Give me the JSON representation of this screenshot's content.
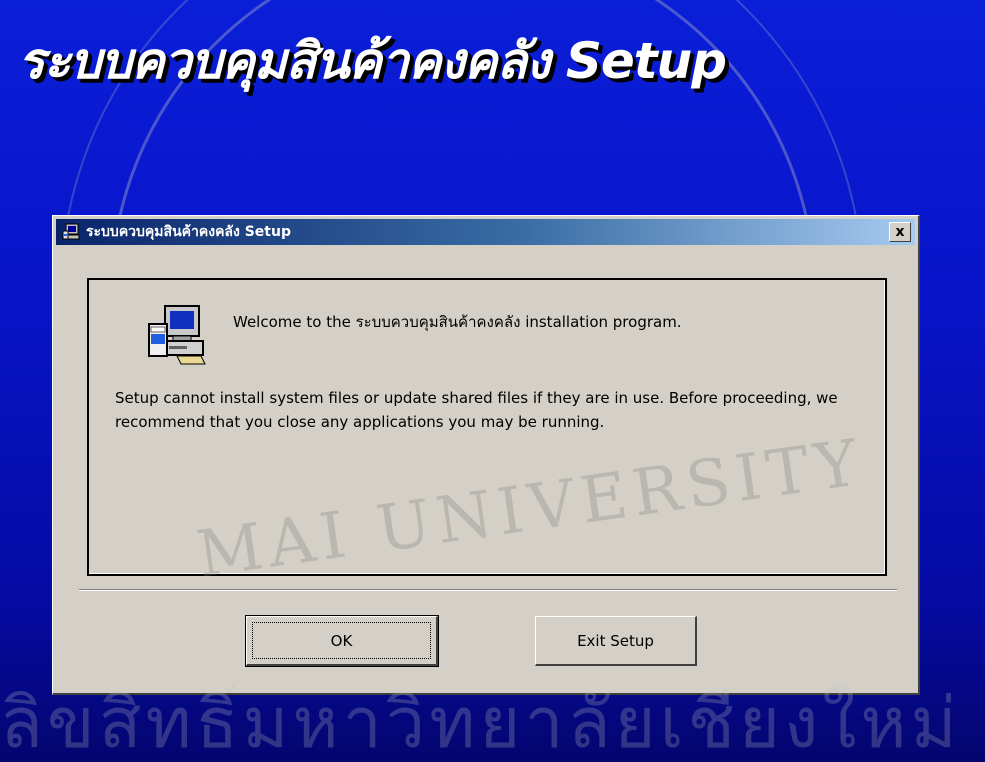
{
  "banner": {
    "title": "ระบบควบคุมสินค้าคงคลัง Setup"
  },
  "watermark": {
    "arc_text": "MAI UNIVERSITY",
    "bottom_text": "ลิขสิทธิ์มหาวิทยาลัยเชียงใหม่"
  },
  "dialog": {
    "title": "ระบบควบคุมสินค้าคงคลัง Setup",
    "close_label": "x",
    "welcome_text": "Welcome to the ระบบควบคุมสินค้าคงคลัง installation program.",
    "body_text": "Setup cannot install system files or update shared files if they are in use. Before proceeding, we recommend that you close any applications you may be running.",
    "ok_label": "OK",
    "exit_label": "Exit Setup"
  },
  "icons": {
    "title_icon": "setup-computer-icon",
    "panel_icon": "setup-computer-icon",
    "close": "close-icon"
  },
  "colors": {
    "background": "#0814c8",
    "titlebar_start": "#0a246a",
    "titlebar_end": "#a6caf0",
    "dialog_face": "#d4d0c8"
  }
}
